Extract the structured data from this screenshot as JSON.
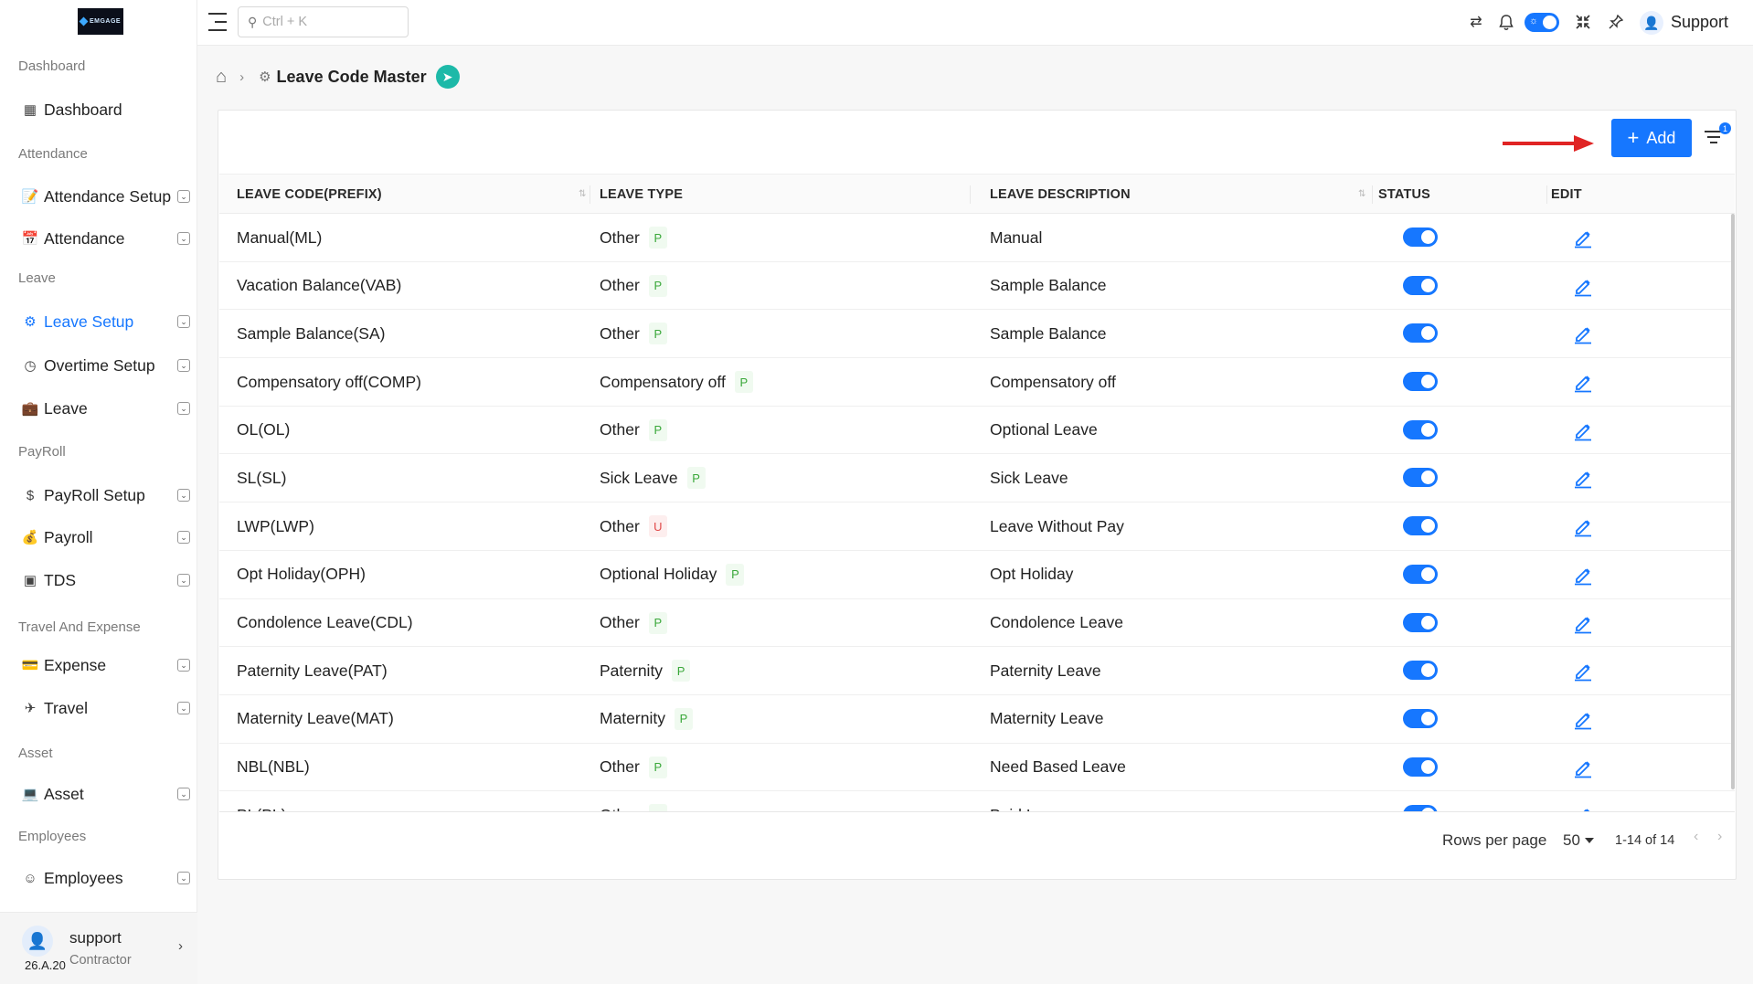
{
  "logo_text": "EMGAGE",
  "sidebar": {
    "sections": [
      {
        "label": "Dashboard",
        "items": [
          {
            "label": "Dashboard",
            "icon": "grid-icon",
            "chevron": false
          }
        ]
      },
      {
        "label": "Attendance",
        "items": [
          {
            "label": "Attendance Setup",
            "icon": "calendar-edit-icon",
            "chevron": true
          },
          {
            "label": "Attendance",
            "icon": "calendar-icon",
            "chevron": true
          }
        ]
      },
      {
        "label": "Leave",
        "items": [
          {
            "label": "Leave Setup",
            "icon": "leave-setup-icon",
            "chevron": true,
            "active": true
          },
          {
            "label": "Overtime Setup",
            "icon": "clock-icon",
            "chevron": true
          },
          {
            "label": "Leave",
            "icon": "bag-icon",
            "chevron": true
          }
        ]
      },
      {
        "label": "PayRoll",
        "items": [
          {
            "label": "PayRoll Setup",
            "icon": "money-icon",
            "chevron": true
          },
          {
            "label": "Payroll",
            "icon": "payroll-icon",
            "chevron": true
          },
          {
            "label": "TDS",
            "icon": "tds-icon",
            "chevron": true
          }
        ]
      },
      {
        "label": "Travel And Expense",
        "items": [
          {
            "label": "Expense",
            "icon": "wallet-icon",
            "chevron": true
          },
          {
            "label": "Travel",
            "icon": "travel-icon",
            "chevron": true
          }
        ]
      },
      {
        "label": "Asset",
        "items": [
          {
            "label": "Asset",
            "icon": "asset-icon",
            "chevron": true
          }
        ]
      },
      {
        "label": "Employees",
        "items": [
          {
            "label": "Employees",
            "icon": "employee-icon",
            "chevron": true
          }
        ]
      }
    ],
    "user": {
      "name": "support",
      "role": "Contractor",
      "version": "26.A.20"
    }
  },
  "topbar": {
    "search_placeholder": "Ctrl + K",
    "support_label": "Support"
  },
  "breadcrumb": {
    "title": "Leave Code Master"
  },
  "toolbar": {
    "add_label": "Add",
    "filter_count": "1"
  },
  "table": {
    "columns": [
      "LEAVE CODE(PREFIX)",
      "LEAVE TYPE",
      "LEAVE DESCRIPTION",
      "STATUS",
      "EDIT"
    ],
    "rows": [
      {
        "code": "Manual(ML)",
        "type": "Other",
        "tag": "P",
        "description": "Manual",
        "status": true
      },
      {
        "code": "Vacation Balance(VAB)",
        "type": "Other",
        "tag": "P",
        "description": "Sample Balance",
        "status": true
      },
      {
        "code": "Sample Balance(SA)",
        "type": "Other",
        "tag": "P",
        "description": "Sample Balance",
        "status": true
      },
      {
        "code": "Compensatory off(COMP)",
        "type": "Compensatory off",
        "tag": "P",
        "description": "Compensatory off",
        "status": true
      },
      {
        "code": "OL(OL)",
        "type": "Other",
        "tag": "P",
        "description": "Optional Leave",
        "status": true
      },
      {
        "code": "SL(SL)",
        "type": "Sick Leave",
        "tag": "P",
        "description": "Sick Leave",
        "status": true
      },
      {
        "code": "LWP(LWP)",
        "type": "Other",
        "tag": "U",
        "description": "Leave Without Pay",
        "status": true
      },
      {
        "code": "Opt Holiday(OPH)",
        "type": "Optional Holiday",
        "tag": "P",
        "description": "Opt Holiday",
        "status": true
      },
      {
        "code": "Condolence Leave(CDL)",
        "type": "Other",
        "tag": "P",
        "description": "Condolence Leave",
        "status": true
      },
      {
        "code": "Paternity Leave(PAT)",
        "type": "Paternity",
        "tag": "P",
        "description": "Paternity Leave",
        "status": true
      },
      {
        "code": "Maternity Leave(MAT)",
        "type": "Maternity",
        "tag": "P",
        "description": "Maternity Leave",
        "status": true
      },
      {
        "code": "NBL(NBL)",
        "type": "Other",
        "tag": "P",
        "description": "Need Based Leave",
        "status": true
      },
      {
        "code": "PL(PL)",
        "type": "Other",
        "tag": "P",
        "description": "Paid Leave",
        "status": true
      }
    ]
  },
  "pagination": {
    "rows_per_page_label": "Rows per page",
    "rows_per_page_value": "50",
    "range": "1-14 of 14"
  },
  "colors": {
    "accent": "#1677ff",
    "arrow": "#e02424",
    "badge": "#1db9a8"
  }
}
